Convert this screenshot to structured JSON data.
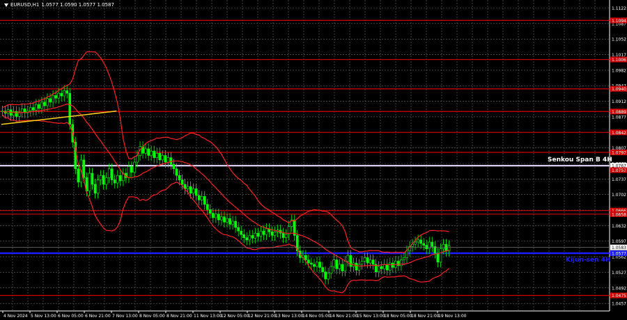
{
  "header": {
    "symbol": "EURUSD,H1",
    "ohlc": "1.0577 1.0590 1.0577 1.0587"
  },
  "colors": {
    "background": "#000000",
    "grid": "#6b6b6b",
    "level_line": "#d40000",
    "candle": "#00ff00",
    "bands": "#ff2020",
    "senkou": "#e6d6ff",
    "kijun": "#1d1dff",
    "trend": "#ffd21a"
  },
  "chart_data": {
    "type": "candlestick",
    "x_tick_labels": [
      "4 Nov 2024",
      "5 Nov 13:00",
      "6 Nov 05:00",
      "6 Nov 21:00",
      "7 Nov 13:00",
      "8 Nov 05:00",
      "8 Nov 21:00",
      "11 Nov 13:00",
      "12 Nov 05:00",
      "12 Nov 21:00",
      "13 Nov 13:00",
      "14 Nov 05:00",
      "14 Nov 21:00",
      "15 Nov 13:00",
      "18 Nov 05:00",
      "18 Nov 21:00",
      "19 Nov 13:00"
    ],
    "y_ticks": [
      "1.1122",
      "1.1087",
      "1.1052",
      "1.1017",
      "1.0982",
      "1.0947",
      "1.0912",
      "1.0877",
      "1.0842",
      "1.0807",
      "1.0772",
      "1.0737",
      "1.0702",
      "1.0667",
      "1.0632",
      "1.0597",
      "1.0562",
      "1.0527",
      "1.0492",
      "1.0457"
    ],
    "y_range": [
      1.044,
      1.114
    ],
    "levels": [
      {
        "price": 1.1094,
        "label": "1.1094"
      },
      {
        "price": 1.1006,
        "label": "1.1006"
      },
      {
        "price": 1.094,
        "label": "1.0940"
      },
      {
        "price": 1.0889,
        "label": "1.0889"
      },
      {
        "price": 1.0842,
        "label": "1.0842"
      },
      {
        "price": 1.0797,
        "label": "1.0797"
      },
      {
        "price": 1.0666,
        "label": "1.0666"
      },
      {
        "price": 1.0658,
        "label": "1.0658"
      },
      {
        "price": 1.0475,
        "label": "1.0475"
      }
    ],
    "senkou_span_b": {
      "price": 1.0767,
      "label": "Senkou Span B 4H",
      "tag": "1.0767"
    },
    "kijun_sen": {
      "price": 1.057,
      "label": "Kijun-sen 4H",
      "tag": "1.0577"
    },
    "current_price": {
      "price": 1.0583,
      "tag": "1.0583"
    },
    "extra_tag": {
      "price": 1.0757,
      "tag": "1.0757"
    },
    "trendline": {
      "x1": 0,
      "y1": 1.086,
      "x2": 41,
      "y2": 1.089
    },
    "closes": [
      1.089,
      1.0885,
      1.0893,
      1.088,
      1.0889,
      1.0878,
      1.0887,
      1.0895,
      1.0886,
      1.089,
      1.0898,
      1.0892,
      1.0905,
      1.0896,
      1.091,
      1.0902,
      1.0918,
      1.091,
      1.0925,
      1.0919,
      1.093,
      1.0924,
      1.0936,
      1.093,
      1.086,
      1.082,
      1.076,
      1.073,
      1.078,
      1.074,
      1.071,
      1.075,
      1.0725,
      1.0705,
      1.0735,
      1.0745,
      1.0725,
      1.074,
      1.076,
      1.0735,
      1.0728,
      1.0745,
      1.0733,
      1.075,
      1.074,
      1.0765,
      1.0752,
      1.0775,
      1.079,
      1.081,
      1.0795,
      1.0805,
      1.079,
      1.08,
      1.0785,
      1.0795,
      1.078,
      1.079,
      1.0775,
      1.0785,
      1.077,
      1.076,
      1.0745,
      1.0735,
      1.0725,
      1.0715,
      1.072,
      1.0705,
      1.0715,
      1.07,
      1.069,
      1.0698,
      1.068,
      1.0668,
      1.066,
      1.065,
      1.0658,
      1.0645,
      1.0652,
      1.064,
      1.0648,
      1.0635,
      1.0642,
      1.0628,
      1.062,
      1.0612,
      1.0605,
      1.06,
      1.061,
      1.0604,
      1.0615,
      1.0608,
      1.062,
      1.0612,
      1.0625,
      1.0618,
      1.061,
      1.0618,
      1.0622,
      1.0615,
      1.0605,
      1.0612,
      1.063,
      1.0645,
      1.061,
      1.0575,
      1.056,
      1.0565,
      1.0555,
      1.0548,
      1.0545,
      1.054,
      1.055,
      1.0538,
      1.0528,
      1.0512,
      1.0525,
      1.054,
      1.0555,
      1.0535,
      1.0545,
      1.053,
      1.0552,
      1.0565,
      1.054,
      1.0548,
      1.0532,
      1.0545,
      1.0552,
      1.056,
      1.0548,
      1.0555,
      1.0545,
      1.0528,
      1.054,
      1.0535,
      1.0545,
      1.0532,
      1.0548,
      1.0538,
      1.0552,
      1.0542,
      1.0555,
      1.056,
      1.0575,
      1.0585,
      1.059,
      1.0595,
      1.06,
      1.0592,
      1.0588,
      1.058,
      1.0595,
      1.0585,
      1.057,
      1.055,
      1.058,
      1.059,
      1.0575,
      1.0587
    ]
  }
}
